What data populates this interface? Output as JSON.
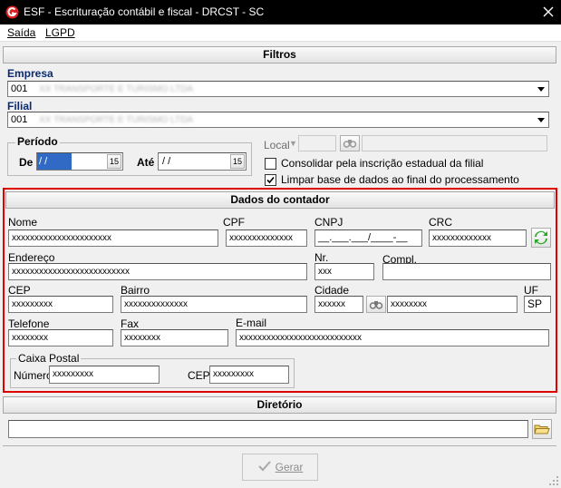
{
  "window": {
    "title": "ESF - Escrituração contábil e fiscal - DRCST - SC"
  },
  "menu": [
    {
      "label": "Saída",
      "mnemonic": "S"
    },
    {
      "label": "LGPD",
      "mnemonic": "L"
    }
  ],
  "filtros": {
    "header": "Filtros",
    "empresa_label": "Empresa",
    "empresa_code": "001",
    "empresa_name": "XX TRANSPORTE E TURISMO LTDA",
    "filial_label": "Filial",
    "filial_code": "001",
    "filial_name": "XX TRANSPORTE E TURISMO LTDA",
    "periodo_label": "Período",
    "de_label": "De",
    "de_value": " / /",
    "ate_label": "Até",
    "ate_value": " / /",
    "calendar_glyph": "15",
    "local_label": "Local",
    "consolidar_label": "Consolidar pela inscrição estadual da filial",
    "consolidar_checked": false,
    "limpar_label": "Limpar base de dados ao final do processamento",
    "limpar_checked": true
  },
  "contador": {
    "header": "Dados do contador",
    "nome_label": "Nome",
    "nome_value": "xxxxxxxxxxxxxxxxxxxxxx",
    "cpf_label": "CPF",
    "cpf_value": "xxxxxxxxxxxxxx",
    "cnpj_label": "CNPJ",
    "cnpj_mask": "__.___.___/____-__",
    "crc_label": "CRC",
    "crc_value": "xxxxxxxxxxxxx",
    "endereco_label": "Endereço",
    "endereco_value": "xxxxxxxxxxxxxxxxxxxxxxxxxx",
    "nr_label": "Nr.",
    "nr_value": "xxx",
    "compl_label": "Compl.",
    "compl_value": "",
    "cep_label": "CEP",
    "cep_value": "xxxxxxxxx",
    "bairro_label": "Bairro",
    "bairro_value": "xxxxxxxxxxxxxx",
    "cidade_label": "Cidade",
    "cidade_code": "xxxxxx",
    "cidade_name": "xxxxxxxx",
    "uf_label": "UF",
    "uf_value": "SP",
    "telefone_label": "Telefone",
    "telefone_value": "xxxxxxxx",
    "fax_label": "Fax",
    "fax_value": "xxxxxxxx",
    "email_label": "E-mail",
    "email_value": "xxxxxxxxxxxxxxxxxxxxxxxxxxx",
    "caixa_postal_label": "Caixa Postal",
    "cp_numero_label": "Número",
    "cp_numero_value": "xxxxxxxxx",
    "cp_cep_label": "CEP",
    "cp_cep_value": "xxxxxxxxx"
  },
  "diretorio": {
    "header": "Diretório",
    "value": ""
  },
  "footer": {
    "gerar_label": "Gerar",
    "gerar_mnemonic": "G"
  },
  "colors": {
    "titlebar": "#000000",
    "highlight_frame": "#e00000",
    "label_blue": "#0b2a72"
  }
}
